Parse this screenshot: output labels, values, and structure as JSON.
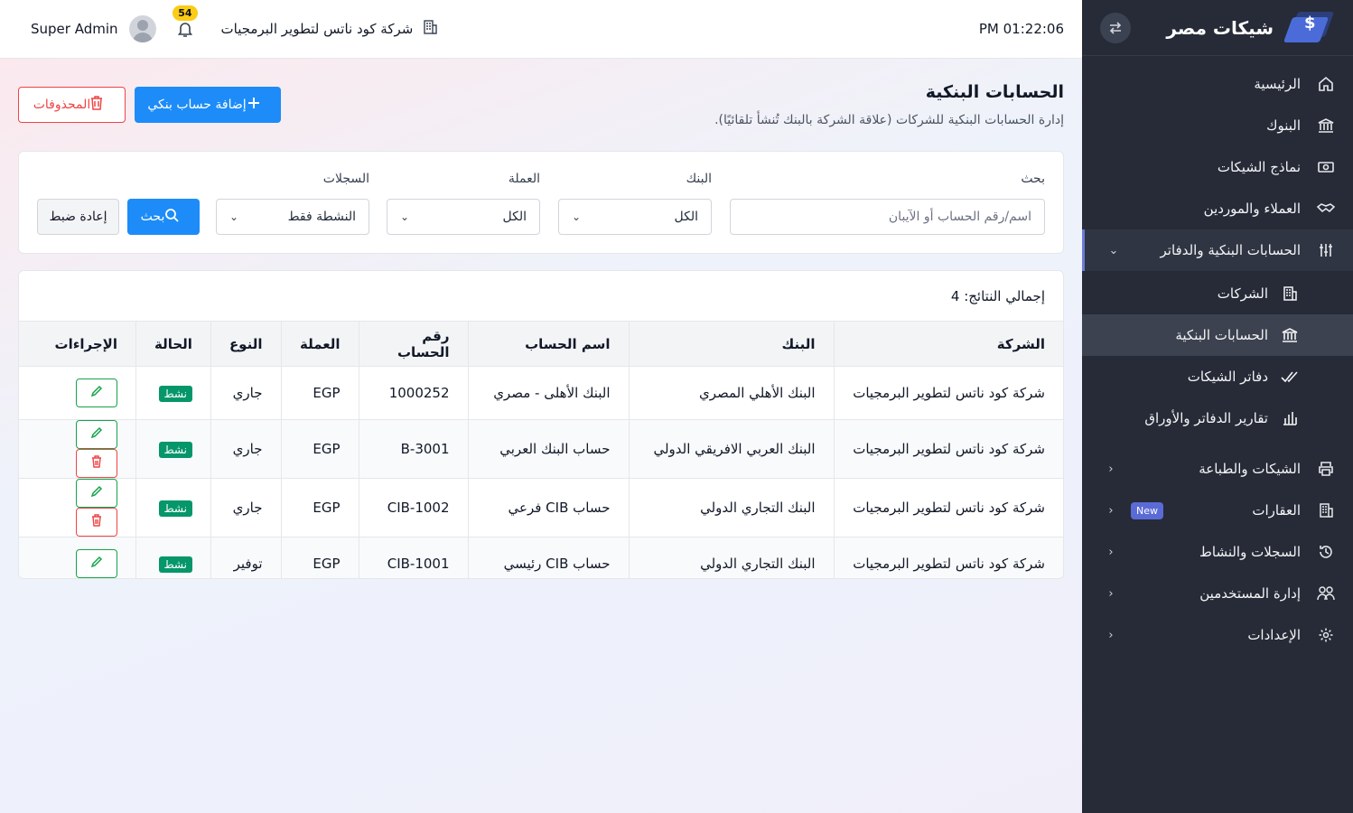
{
  "sidebar": {
    "brand": "شيكات مصر",
    "items": [
      {
        "label": "الرئيسية"
      },
      {
        "label": "البنوك"
      },
      {
        "label": "نماذج الشيكات"
      },
      {
        "label": "العملاء والموردين"
      },
      {
        "label": "الحسابات البنكية والدفاتر"
      },
      {
        "label": "الشيكات والطباعة"
      },
      {
        "label": "العقارات",
        "badge": "New"
      },
      {
        "label": "السجلات والنشاط"
      },
      {
        "label": "إدارة المستخدمين"
      },
      {
        "label": "الإعدادات"
      }
    ],
    "sub_items": [
      {
        "label": "الشركات"
      },
      {
        "label": "الحسابات البنكية"
      },
      {
        "label": "دفاتر الشيكات"
      },
      {
        "label": "تقارير الدفاتر والأوراق"
      }
    ]
  },
  "topbar": {
    "clock": "PM 01:22:06",
    "company": "شركة كود ناتس لتطوير البرمجيات",
    "notifications_count": "54",
    "username": "Super Admin"
  },
  "page": {
    "title": "الحسابات البنكية",
    "subtitle": "إدارة الحسابات البنكية للشركات (علاقة الشركة بالبنك تُنشأ تلقائيًا).",
    "add_button": "إضافة حساب بنكي",
    "deleted_button": "المحذوفات"
  },
  "filters": {
    "search_label": "بحث",
    "search_placeholder": "اسم/رقم الحساب أو الآيبان",
    "bank_label": "البنك",
    "bank_value": "الكل",
    "currency_label": "العملة",
    "currency_value": "الكل",
    "records_label": "السجلات",
    "records_value": "النشطة فقط",
    "search_button": "بحث",
    "reset_button": "إعادة ضبط"
  },
  "results": {
    "total": "إجمالي النتائج: 4",
    "columns": [
      "الشركة",
      "البنك",
      "اسم الحساب",
      "رقم الحساب",
      "العملة",
      "النوع",
      "الحالة",
      "الإجراءات"
    ],
    "rows": [
      {
        "company": "شركة كود ناتس لتطوير البرمجيات",
        "bank": "البنك الأهلي المصري",
        "account_name": "البنك الأهلى - مصري",
        "account_no": "1000252",
        "currency": "EGP",
        "type": "جاري",
        "status": "نشط",
        "deletable": false
      },
      {
        "company": "شركة كود ناتس لتطوير البرمجيات",
        "bank": "البنك العربي الافريقي الدولي",
        "account_name": "حساب البنك العربي",
        "account_no": "B-3001",
        "currency": "EGP",
        "type": "جاري",
        "status": "نشط",
        "deletable": true
      },
      {
        "company": "شركة كود ناتس لتطوير البرمجيات",
        "bank": "البنك التجاري الدولي",
        "account_name": "حساب CIB فرعي",
        "account_no": "CIB-1002",
        "currency": "EGP",
        "type": "جاري",
        "status": "نشط",
        "deletable": true
      },
      {
        "company": "شركة كود ناتس لتطوير البرمجيات",
        "bank": "البنك التجاري الدولي",
        "account_name": "حساب CIB رئيسي",
        "account_no": "CIB-1001",
        "currency": "EGP",
        "type": "توفير",
        "status": "نشط",
        "deletable": false
      }
    ]
  },
  "icons": {
    "home": "home-icon",
    "bank": "bank-icon",
    "cheque": "cheque-template-icon",
    "handshake": "handshake-icon",
    "sliders": "sliders-icon",
    "building": "building-icon",
    "check": "checkmark-icon",
    "chart": "bar-chart-icon",
    "printer": "printer-icon",
    "property": "property-icon",
    "history": "history-icon",
    "users": "users-icon",
    "gear": "gear-icon",
    "swap": "swap-icon",
    "bell": "bell-icon",
    "plus": "plus-icon",
    "trash": "trash-icon",
    "search": "search-icon",
    "pencil": "pencil-icon"
  },
  "colors": {
    "sidebar_bg": "#262b37",
    "primary": "#1d8cf8",
    "danger": "#ef4444",
    "success": "#16a34a",
    "badge_yellow": "#facc15",
    "new_badge": "#5b6bd6"
  }
}
